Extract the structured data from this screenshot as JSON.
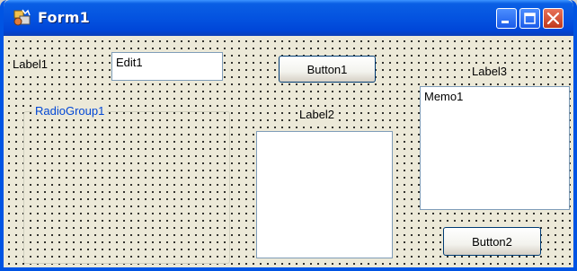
{
  "window": {
    "title": "Form1",
    "controls": [
      "minimize-icon",
      "maximize-icon",
      "close-icon"
    ]
  },
  "form": {
    "label1": "Label1",
    "edit1": "Edit1",
    "button1": "Button1",
    "label2": "Label2",
    "label3": "Label3",
    "radiogroup_caption": "RadioGroup1",
    "memo1": "Memo1",
    "button2": "Button2"
  },
  "colors": {
    "titlebar": "#0453e0",
    "form_bg": "#ece9d8",
    "close_button": "#c0381b",
    "groupbox_caption": "#0046d5"
  }
}
